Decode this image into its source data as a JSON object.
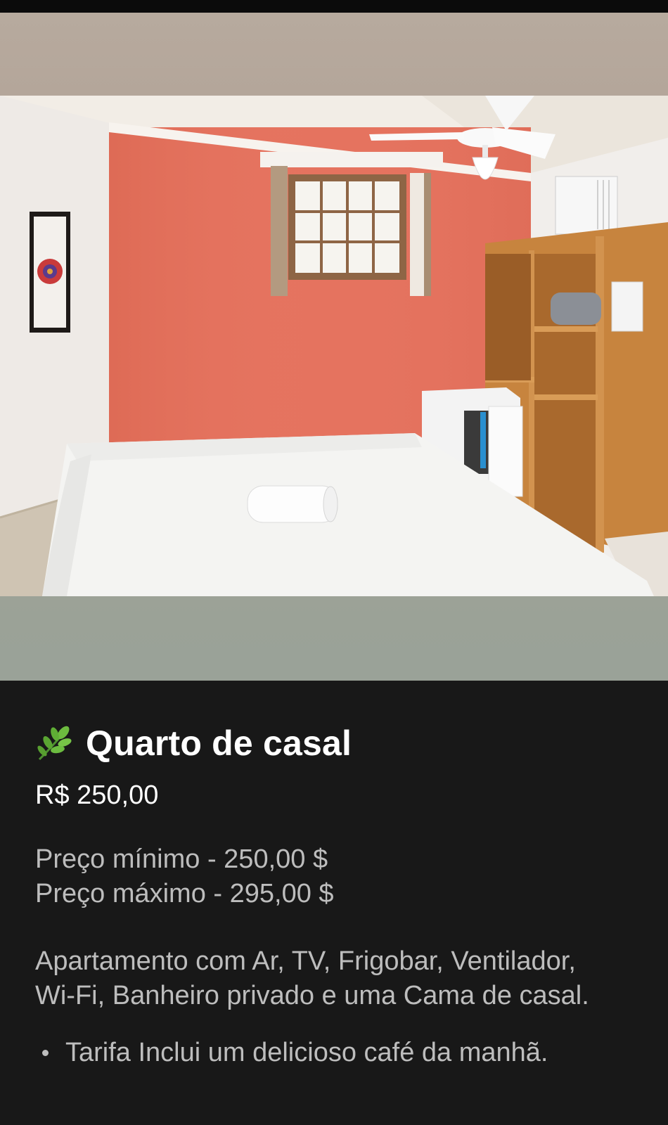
{
  "listing": {
    "photo_alt": "Quarto de casal",
    "title_icon": "herb-leaf-icon",
    "title": "Quarto de casal",
    "price": "R$ 250,00",
    "price_min": "Preço mínimo - 250,00 $",
    "price_max": "Preço máximo - 295,00 $",
    "description_line1": "Apartamento com Ar, TV, Frigobar, Ventilador,",
    "description_line2": "Wi-Fi, Banheiro privado e uma Cama de casal.",
    "bullets": [
      "Tarifa Inclui um delicioso café da manhã."
    ]
  },
  "colors": {
    "background": "#181818",
    "title_text": "#ffffff",
    "body_text": "#bdbdbd",
    "accent_wall": "#e5735f"
  }
}
